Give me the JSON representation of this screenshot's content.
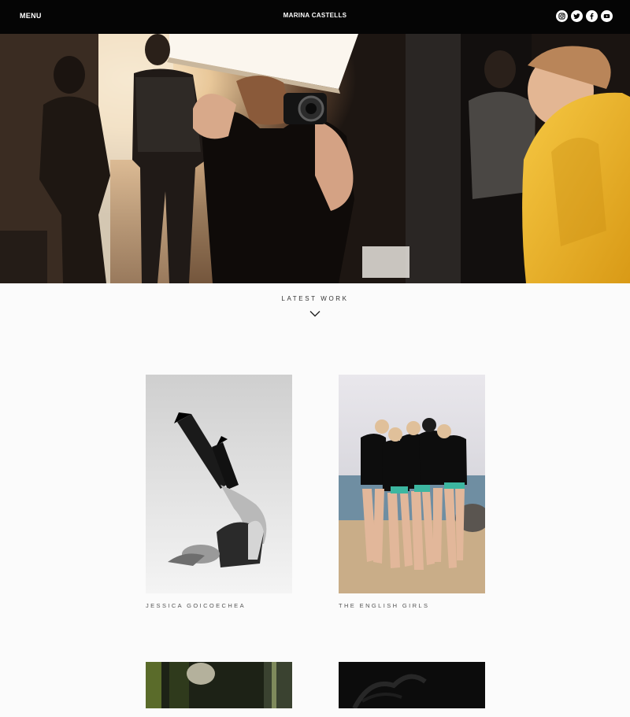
{
  "header": {
    "menu_label": "MENU",
    "site_title": "MARINA CASTELLS",
    "social_icons": [
      "instagram-icon",
      "twitter-icon",
      "facebook-icon",
      "youtube-icon"
    ]
  },
  "hero": {
    "image_description": "Behind-the-scenes photo shoot: photographer with camera, softbox light, crew in dark studio, person in yellow jacket"
  },
  "latest_work": {
    "heading": "LATEST WORK"
  },
  "portfolio": [
    {
      "caption": "JESSICA GOICOECHEA"
    },
    {
      "caption": "THE ENGLISH GIRLS"
    },
    {
      "caption": ""
    },
    {
      "caption": ""
    }
  ],
  "colors": {
    "header_bg": "#050505",
    "page_bg": "#fbfbfb",
    "accent_yellow": "#f2b82a"
  }
}
